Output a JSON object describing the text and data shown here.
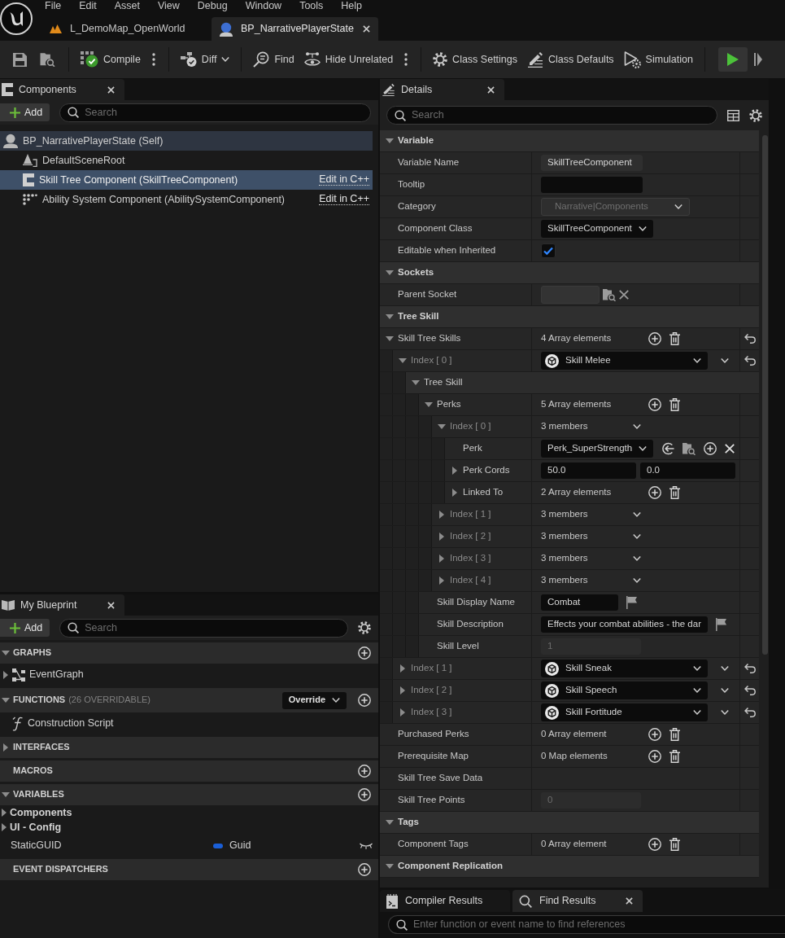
{
  "menu_bar": [
    "File",
    "Edit",
    "Asset",
    "View",
    "Debug",
    "Window",
    "Tools",
    "Help"
  ],
  "document_tabs": [
    {
      "label": "L_DemoMap_OpenWorld",
      "kind": "level",
      "selected": false
    },
    {
      "label": "BP_NarrativePlayerState",
      "kind": "blueprint",
      "selected": true
    }
  ],
  "toolbar": [
    {
      "kind": "compile",
      "label": "Compile"
    },
    {
      "kind": "diff",
      "label": "Diff"
    },
    {
      "kind": "find",
      "label": "Find"
    },
    {
      "kind": "hide",
      "label": "Hide Unrelated"
    },
    {
      "kind": "settings",
      "label": "Class Settings"
    },
    {
      "kind": "defaults",
      "label": "Class Defaults"
    },
    {
      "kind": "simulation",
      "label": "Simulation"
    }
  ],
  "components_panel": {
    "tab": "Components",
    "add_button": "Add",
    "search": {
      "placeholder": "Search"
    },
    "tree": [
      {
        "label": "BP_NarrativePlayerState (Self)",
        "kind": "self",
        "selected": false,
        "children": [
          {
            "label": "DefaultSceneRoot",
            "kind": "scene",
            "selected": false
          },
          {
            "label": "Skill Tree Component (SkillTreeComponent)",
            "kind": "component",
            "selected": true,
            "link": "Edit in C++"
          },
          {
            "label": "Ability System Component (AbilitySystemComponent)",
            "kind": "ability",
            "selected": false,
            "link": "Edit in C++"
          }
        ]
      }
    ]
  },
  "my_blueprint": {
    "tab": "My Blueprint",
    "add_button": "Add",
    "search": {
      "placeholder": "Search"
    },
    "sections": [
      {
        "title": "GRAPHS",
        "expanded": true,
        "add": true,
        "items": [
          {
            "label": "EventGraph",
            "kind": "graph",
            "expanded": false
          }
        ]
      },
      {
        "title": "FUNCTIONS",
        "note": "(26 OVERRIDABLE)",
        "dropdown": "Override",
        "expanded": true,
        "add": true,
        "items": [
          {
            "label": "Construction Script",
            "kind": "function"
          }
        ]
      },
      {
        "title": "INTERFACES",
        "expanded": false,
        "add": false
      },
      {
        "title": "MACROS",
        "add": true
      },
      {
        "title": "VARIABLES",
        "expanded": true,
        "add": true,
        "items": [
          {
            "label": "Components",
            "kind": "category",
            "expanded": false
          },
          {
            "label": "UI - Config",
            "kind": "category",
            "expanded": false
          },
          {
            "label": "StaticGUID",
            "kind": "variable",
            "type": "Guid",
            "color": "#1a5fd8"
          }
        ]
      },
      {
        "title": "EVENT DISPATCHERS",
        "add": true
      }
    ]
  },
  "details_panel": {
    "tab": "Details",
    "search": {
      "placeholder": "Search"
    },
    "categories": [
      {
        "title": "Variable",
        "expanded": true,
        "rows": [
          {
            "label": "Variable Name",
            "kind": "name",
            "value": "SkillTreeComponent"
          },
          {
            "label": "Tooltip",
            "kind": "textbox",
            "disabled": false,
            "localized": false
          },
          {
            "label": "Category",
            "kind": "dropdown",
            "value": "Narrative|Components",
            "disabled": true
          },
          {
            "label": "Component Class",
            "kind": "dropdown",
            "value": "SkillTreeComponent",
            "disabled": false
          },
          {
            "label": "Editable when Inherited",
            "kind": "checkbox",
            "checked": true
          }
        ]
      },
      {
        "title": "Sockets",
        "expanded": true,
        "rows": [
          {
            "label": "Parent Socket",
            "kind": "socket"
          }
        ]
      },
      {
        "title": "Tree Skill",
        "expanded": true,
        "rows": [
          {
            "label": "Skill Tree Skills",
            "kind": "array",
            "value": "4 Array elements",
            "expanded": true,
            "reset": true,
            "children": [
              {
                "label": "Index [ 0 ]",
                "kind": "asset",
                "value": "Skill Melee",
                "expanded": true,
                "reset": true,
                "children": [
                  {
                    "label": "Tree Skill",
                    "kind": "group",
                    "expanded": true,
                    "children": [
                      {
                        "label": "Perks",
                        "kind": "array",
                        "value": "5 Array elements",
                        "expanded": true,
                        "children": [
                          {
                            "label": "Index [ 0 ]",
                            "kind": "struct",
                            "value": "3 members",
                            "expanded": true,
                            "children": [
                              {
                                "label": "Perk",
                                "kind": "object",
                                "value": "Perk_SuperStrength"
                              },
                              {
                                "label": "Perk Cords",
                                "kind": "vector2",
                                "values": [
                                  "50.0",
                                  "0.0"
                                ],
                                "expanded": false
                              },
                              {
                                "label": "Linked To",
                                "kind": "array",
                                "value": "2 Array elements",
                                "expanded": false
                              }
                            ]
                          },
                          {
                            "label": "Index [ 1 ]",
                            "kind": "struct",
                            "value": "3 members",
                            "expanded": false
                          },
                          {
                            "label": "Index [ 2 ]",
                            "kind": "struct",
                            "value": "3 members",
                            "expanded": false
                          },
                          {
                            "label": "Index [ 3 ]",
                            "kind": "struct",
                            "value": "3 members",
                            "expanded": false
                          },
                          {
                            "label": "Index [ 4 ]",
                            "kind": "struct",
                            "value": "3 members",
                            "expanded": false
                          }
                        ]
                      },
                      {
                        "label": "Skill Display Name",
                        "kind": "textbox",
                        "value": "Combat",
                        "disabled": false,
                        "localized": true
                      },
                      {
                        "label": "Skill Description",
                        "kind": "textbox",
                        "value": "Effects your combat abilities - the dar",
                        "disabled": false,
                        "localized": true
                      },
                      {
                        "label": "Skill Level",
                        "kind": "textbox",
                        "value": "1",
                        "disabled": true,
                        "localized": false
                      }
                    ]
                  }
                ]
              },
              {
                "label": "Index [ 1 ]",
                "kind": "asset",
                "value": "Skill Sneak",
                "expanded": false,
                "reset": true
              },
              {
                "label": "Index [ 2 ]",
                "kind": "asset",
                "value": "Skill Speech",
                "expanded": false,
                "reset": true
              },
              {
                "label": "Index [ 3 ]",
                "kind": "asset",
                "value": "Skill Fortitude",
                "expanded": false,
                "reset": true
              }
            ]
          },
          {
            "label": "Purchased Perks",
            "kind": "array",
            "value": "0 Array element",
            "reset": false
          },
          {
            "label": "Prerequisite Map",
            "kind": "array",
            "value": "0 Map elements",
            "reset": false
          },
          {
            "label": "Skill Tree Save Data",
            "kind": "empty",
            "reset": false
          },
          {
            "label": "Skill Tree Points",
            "kind": "textbox",
            "value": "0",
            "disabled": true,
            "localized": false,
            "reset": false
          }
        ]
      },
      {
        "title": "Tags",
        "expanded": true,
        "rows": [
          {
            "label": "Component Tags",
            "kind": "array",
            "value": "0 Array element"
          }
        ]
      },
      {
        "title": "Component Replication",
        "expanded": true
      }
    ]
  },
  "bottom_panel": {
    "tabs": [
      {
        "label": "Compiler Results",
        "kind": "log",
        "selected": false
      },
      {
        "label": "Find Results",
        "kind": "search",
        "selected": true
      }
    ],
    "search": {
      "placeholder": "Enter function or event name to find references"
    }
  }
}
